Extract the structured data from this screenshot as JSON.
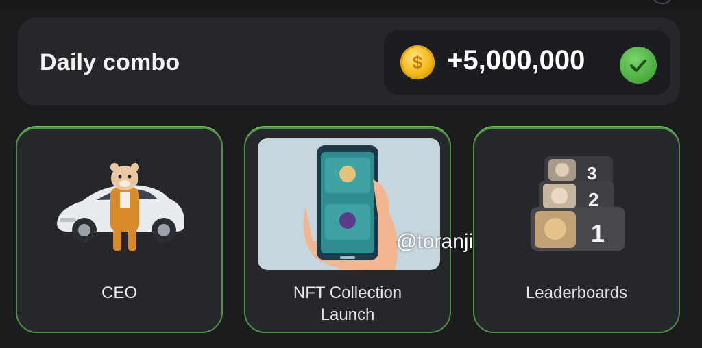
{
  "daily_combo": {
    "title": "Daily combo",
    "reward_amount": "+5,000,000",
    "coin_symbol": "$",
    "completed_icon": "check-icon"
  },
  "cards": [
    {
      "label": "CEO",
      "art": "hamster-with-car"
    },
    {
      "label": "NFT Collection Launch",
      "label_line1": "NFT Collection",
      "label_line2": "Launch",
      "art": "phone-in-hand"
    },
    {
      "label": "Leaderboards",
      "art": "ranked-hamsters",
      "ranks": [
        "3",
        "2",
        "1"
      ]
    }
  ],
  "watermark": "@toranji",
  "colors": {
    "background": "#1b1c1e",
    "panel": "#26272b",
    "card_border": "#6fbf5f",
    "coin": "#f2b81c",
    "check": "#4fb043"
  }
}
